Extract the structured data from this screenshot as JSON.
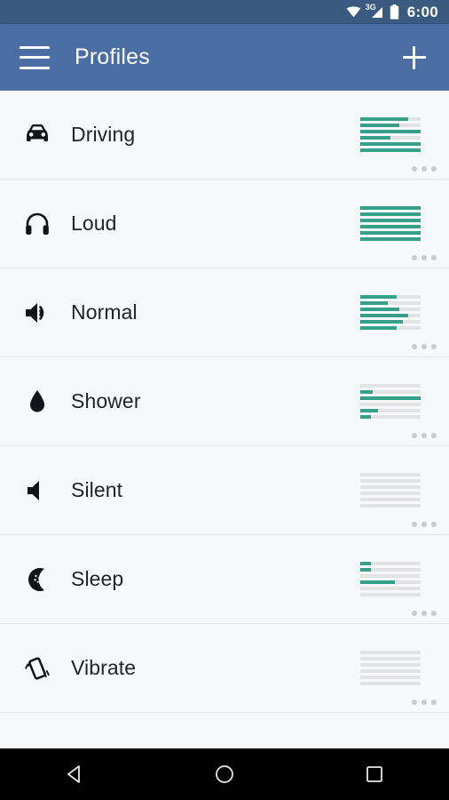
{
  "statusbar": {
    "time": "6:00",
    "network_label": "3G",
    "icons": [
      "wifi-icon",
      "signal-3g-icon",
      "battery-icon"
    ]
  },
  "appbar": {
    "title": "Profiles",
    "menu_icon": "hamburger-menu-icon",
    "add_icon": "plus-icon"
  },
  "colors": {
    "statusbar_bg": "#3b5a80",
    "appbar_bg": "#4a6da3",
    "list_bg": "#f7f8fa",
    "bar_fill": "#36a089",
    "bar_track": "#e3e3e5",
    "divider": "#e4e5e8",
    "label_text": "#20242a",
    "overflow_dot": "#c9cacd",
    "navbar_bg": "#000000"
  },
  "list": {
    "overflow_label": "more-options",
    "items": [
      {
        "label": "Driving",
        "icon": "car-icon",
        "levels": [
          80,
          65,
          100,
          50,
          100,
          100
        ]
      },
      {
        "label": "Loud",
        "icon": "headphones-icon",
        "levels": [
          100,
          100,
          100,
          100,
          100,
          100
        ]
      },
      {
        "label": "Normal",
        "icon": "volume-up-icon",
        "levels": [
          60,
          45,
          65,
          80,
          70,
          60
        ]
      },
      {
        "label": "Shower",
        "icon": "water-drop-icon",
        "levels": [
          0,
          20,
          100,
          0,
          30,
          18
        ]
      },
      {
        "label": "Silent",
        "icon": "volume-mute-icon",
        "levels": [
          0,
          0,
          0,
          0,
          0,
          0
        ]
      },
      {
        "label": "Sleep",
        "icon": "moon-icon",
        "levels": [
          18,
          18,
          0,
          57,
          0,
          0
        ]
      },
      {
        "label": "Vibrate",
        "icon": "vibrate-icon",
        "levels": [
          0,
          0,
          0,
          0,
          0,
          0
        ]
      }
    ]
  },
  "navbar": {
    "back_label": "back-button",
    "home_label": "home-button",
    "recents_label": "recents-button"
  }
}
